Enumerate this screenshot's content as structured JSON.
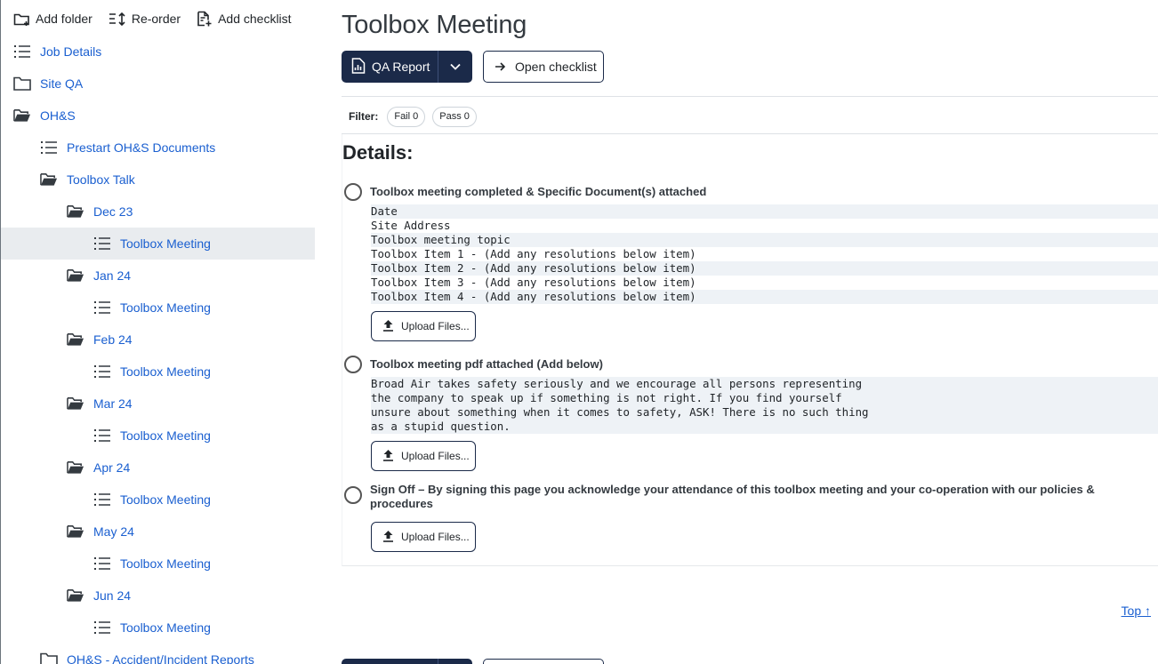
{
  "toolbar": {
    "add_folder": "Add folder",
    "reorder": "Re-order",
    "add_checklist": "Add checklist"
  },
  "sidebar": {
    "items": [
      {
        "label": "Job Details",
        "icon": "list-icon",
        "level": 0
      },
      {
        "label": "Site QA",
        "icon": "folder-icon",
        "level": 0
      },
      {
        "label": "OH&S",
        "icon": "folder-open-icon",
        "level": 0
      },
      {
        "label": "Prestart OH&S Documents",
        "icon": "list-icon",
        "level": 1
      },
      {
        "label": "Toolbox Talk",
        "icon": "folder-open-icon",
        "level": 1
      },
      {
        "label": "Dec 23",
        "icon": "folder-open-icon",
        "level": 2
      },
      {
        "label": "Toolbox Meeting",
        "icon": "list-icon",
        "level": 3,
        "active": true
      },
      {
        "label": "Jan 24",
        "icon": "folder-open-icon",
        "level": 2
      },
      {
        "label": "Toolbox Meeting",
        "icon": "list-icon",
        "level": 3
      },
      {
        "label": "Feb 24",
        "icon": "folder-open-icon",
        "level": 2
      },
      {
        "label": "Toolbox Meeting",
        "icon": "list-icon",
        "level": 3
      },
      {
        "label": "Mar 24",
        "icon": "folder-open-icon",
        "level": 2
      },
      {
        "label": "Toolbox Meeting",
        "icon": "list-icon",
        "level": 3
      },
      {
        "label": "Apr 24",
        "icon": "folder-open-icon",
        "level": 2
      },
      {
        "label": "Toolbox Meeting",
        "icon": "list-icon",
        "level": 3
      },
      {
        "label": "May 24",
        "icon": "folder-open-icon",
        "level": 2
      },
      {
        "label": "Toolbox Meeting",
        "icon": "list-icon",
        "level": 3
      },
      {
        "label": "Jun 24",
        "icon": "folder-open-icon",
        "level": 2
      },
      {
        "label": "Toolbox Meeting",
        "icon": "list-icon",
        "level": 3
      },
      {
        "label": "OH&S - Accident/Incident Reports",
        "icon": "folder-icon",
        "level": 1
      }
    ]
  },
  "main": {
    "title": "Toolbox Meeting",
    "qa_report_label": "QA Report",
    "open_checklist_label": "Open checklist",
    "filter": {
      "label": "Filter:",
      "fail": "Fail 0",
      "pass": "Pass 0"
    },
    "details_heading": "Details:",
    "checklist_items": [
      {
        "title": "Toolbox meeting completed & Specific Document(s) attached",
        "notes": [
          "Date",
          "Site Address",
          "Toolbox meeting topic",
          "Toolbox Item 1 - (Add any resolutions below item)",
          "Toolbox Item 2 - (Add any resolutions below item)",
          "Toolbox Item 3 - (Add any resolutions below item)",
          "Toolbox Item 4 - (Add any resolutions below item)"
        ],
        "upload_label": "Upload Files..."
      },
      {
        "title": "Toolbox meeting pdf attached (Add below)",
        "notes": [
          "Broad Air takes safety seriously and we encourage all persons representing",
          "the company to speak up if something is not right. If you find yourself",
          "unsure about something when it comes to safety, ASK! There is no such thing",
          "as a stupid question."
        ],
        "upload_label": "Upload Files..."
      },
      {
        "title_line1": "Sign Off – By signing this page you acknowledge your attendance of this toolbox meeting and your co-operation with our policies &",
        "title_line2": "procedures",
        "upload_label": "Upload Files..."
      }
    ],
    "top_link": "Top ↑"
  },
  "colors": {
    "primary_dark": "#1b2a49",
    "link_blue": "#1a5fd0",
    "active_row": "#e9ecef",
    "note_shade": "#eef2f6"
  }
}
